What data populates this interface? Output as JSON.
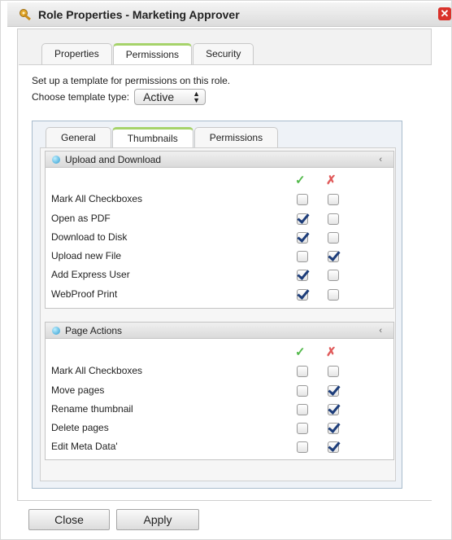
{
  "window": {
    "title": "Role Properties - Marketing Approver",
    "close_label": "✕"
  },
  "top_tabs": [
    {
      "label": "Properties",
      "active": false
    },
    {
      "label": "Permissions",
      "active": true
    },
    {
      "label": "Security",
      "active": false
    }
  ],
  "template": {
    "description": "Set up a template for permissions on this role.",
    "choose_label": "Choose template type:",
    "selected": "Active"
  },
  "inner_tabs": [
    {
      "label": "General",
      "active": false
    },
    {
      "label": "Thumbnails",
      "active": true
    },
    {
      "label": "Permissions",
      "active": false
    }
  ],
  "sections": [
    {
      "title": "Upload and Download",
      "columns": {
        "allow_icon": "✓",
        "deny_icon": "✗"
      },
      "rows": [
        {
          "label": "Mark All Checkboxes",
          "allow": false,
          "deny": false
        },
        {
          "label": "Open as PDF",
          "allow": true,
          "deny": false
        },
        {
          "label": "Download to Disk",
          "allow": true,
          "deny": false
        },
        {
          "label": "Upload new File",
          "allow": false,
          "deny": true
        },
        {
          "label": "Add Express User",
          "allow": true,
          "deny": false
        },
        {
          "label": "WebProof Print",
          "allow": true,
          "deny": false
        }
      ]
    },
    {
      "title": "Page Actions",
      "columns": {
        "allow_icon": "✓",
        "deny_icon": "✗"
      },
      "rows": [
        {
          "label": "Mark All Checkboxes",
          "allow": false,
          "deny": false
        },
        {
          "label": "Move pages",
          "allow": false,
          "deny": true
        },
        {
          "label": "Rename thumbnail",
          "allow": false,
          "deny": true
        },
        {
          "label": "Delete pages",
          "allow": false,
          "deny": true
        },
        {
          "label": "Edit Meta Data'",
          "allow": false,
          "deny": true
        }
      ]
    }
  ],
  "buttons": {
    "close": "Close",
    "apply": "Apply"
  },
  "colors": {
    "allow": "#52b94a",
    "deny": "#e05a5a",
    "active_tab_accent": "#a6d36a",
    "checkmark": "#1d3d7a"
  }
}
